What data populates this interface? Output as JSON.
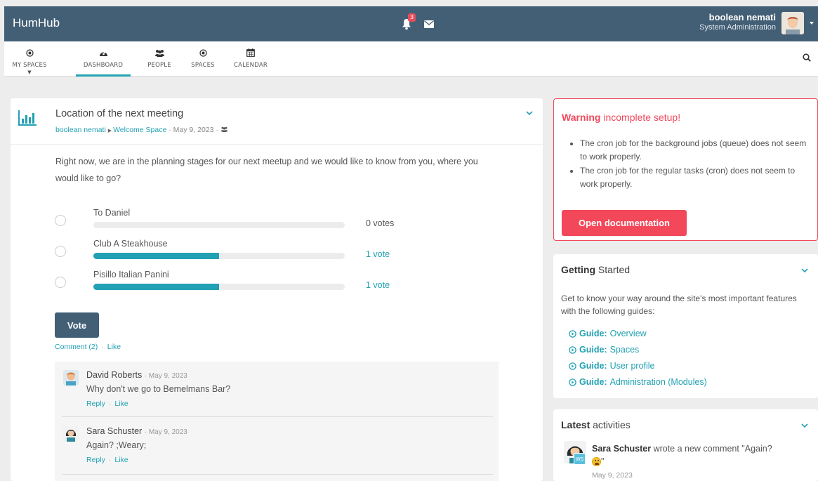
{
  "topbar": {
    "brand": "HumHub",
    "notification_count": "3",
    "user_name": "boolean nemati",
    "user_role": "System Administration"
  },
  "nav": {
    "items": [
      {
        "label": "MY SPACES",
        "icon": "dot-circle-icon"
      },
      {
        "label": "DASHBOARD",
        "icon": "tachometer-icon"
      },
      {
        "label": "PEOPLE",
        "icon": "users-icon"
      },
      {
        "label": "SPACES",
        "icon": "dot-circle-icon"
      },
      {
        "label": "CALENDAR",
        "icon": "calendar-icon"
      }
    ],
    "active": "DASHBOARD"
  },
  "post": {
    "title": "Location of the next meeting",
    "author": "boolean nemati",
    "space": "Welcome Space",
    "date": "May 9, 2023",
    "text": "Right now, we are in the planning stages for our next meetup and we would like to know from you, where you would like to go?",
    "options": [
      {
        "label": "To Daniel",
        "votes": "0 votes",
        "fraction": 0,
        "votes_color": "#555555"
      },
      {
        "label": "Club A Steakhouse",
        "votes": "1 vote",
        "fraction": 0.5,
        "votes_color": "#21a1b3"
      },
      {
        "label": "Pisillo Italian Panini",
        "votes": "1 vote",
        "fraction": 0.5,
        "votes_color": "#21a1b3"
      }
    ],
    "vote_button": "Vote",
    "comment_link": "Comment (2)",
    "like_link": "Like"
  },
  "comments": [
    {
      "author": "David Roberts",
      "date": "May 9, 2023",
      "text": "Why don't we go to Bemelmans Bar?",
      "reply": "Reply",
      "like": "Like"
    },
    {
      "author": "Sara Schuster",
      "date": "May 9, 2023",
      "text": "Again? ;Weary;",
      "reply": "Reply",
      "like": "Like"
    }
  ],
  "warning": {
    "title_bold": "Warning",
    "title_rest": "incomplete setup!",
    "items": [
      "The cron job for the background jobs (queue) does not seem to work properly.",
      "The cron job for the regular tasks (cron) does not seem to work properly."
    ],
    "button": "Open documentation"
  },
  "getting_started": {
    "title_bold": "Getting",
    "title_rest": "Started",
    "text": "Get to know your way around the site's most important features with the following guides:",
    "guides": [
      {
        "prefix": "Guide:",
        "label": "Overview"
      },
      {
        "prefix": "Guide:",
        "label": "Spaces"
      },
      {
        "prefix": "Guide:",
        "label": "User profile"
      },
      {
        "prefix": "Guide:",
        "label": "Administration (Modules)"
      }
    ]
  },
  "latest": {
    "title_bold": "Latest",
    "title_rest": "activities",
    "author": "Sara Schuster",
    "text": "wrote a new comment \"Again?",
    "text_end": "\"",
    "badge": "WS",
    "date": "May 9, 2023"
  },
  "colors": {
    "topbar": "#435f75",
    "accent": "#21a1b3",
    "warning": "#f2485a"
  }
}
